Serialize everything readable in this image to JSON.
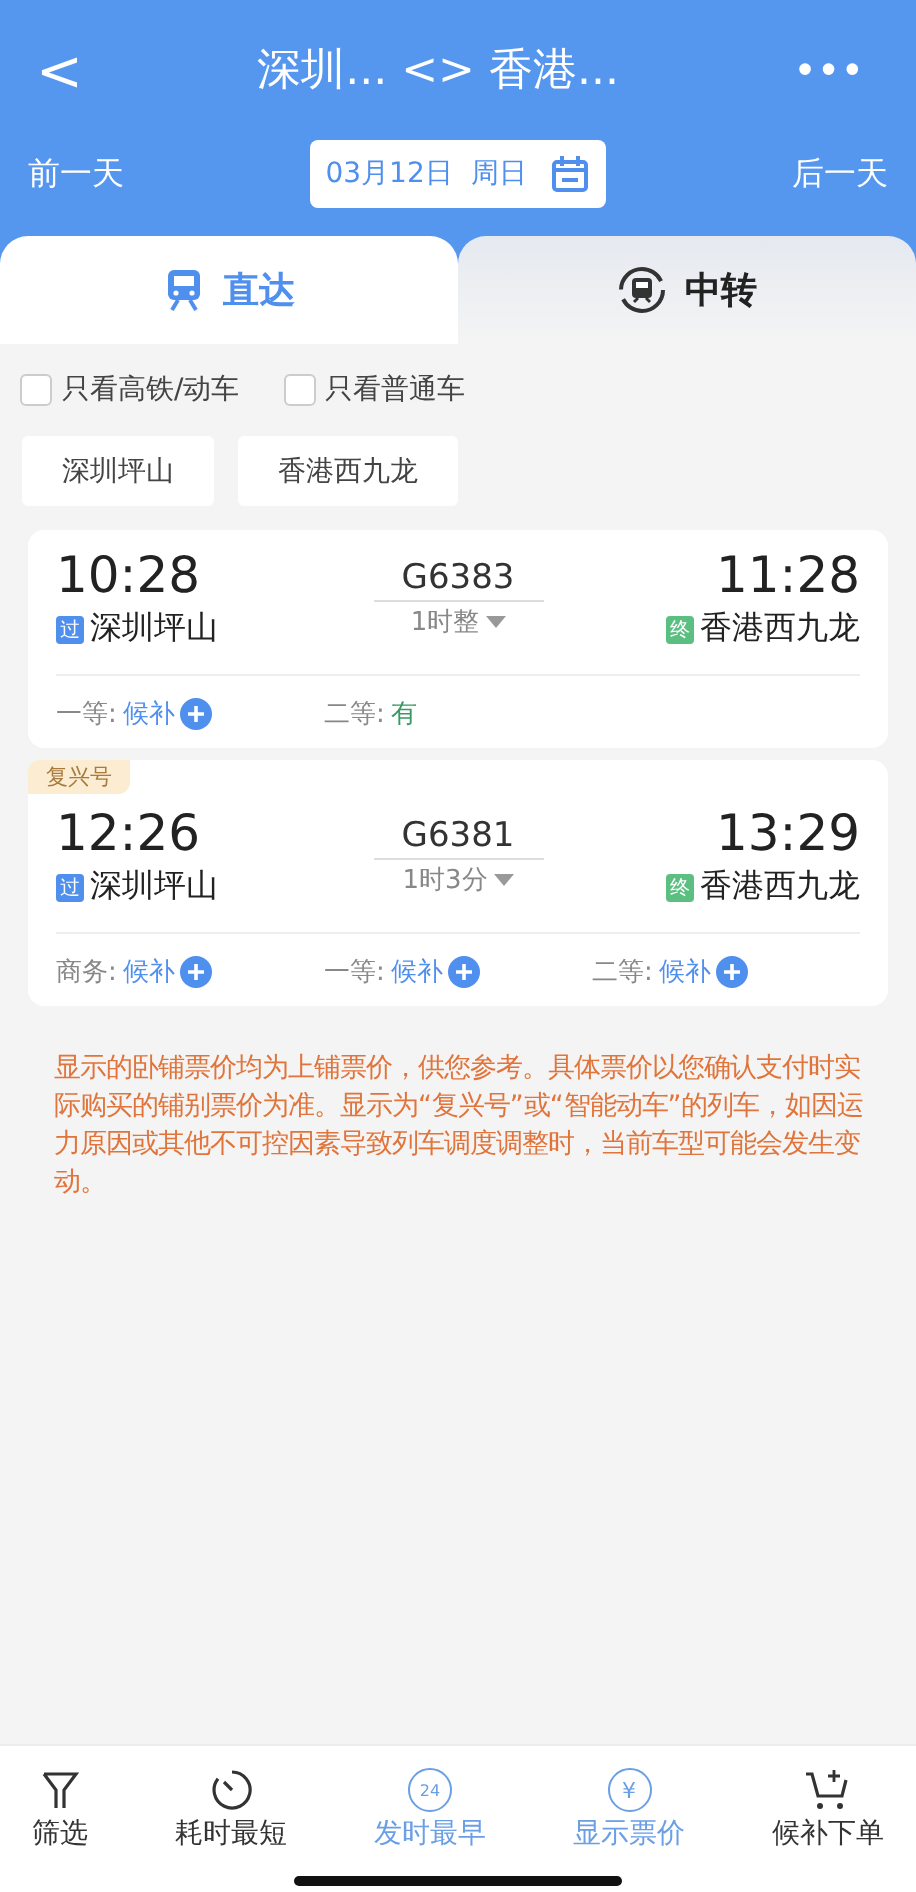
{
  "header": {
    "back": "<",
    "title": "深圳... <> 香港...",
    "more": "•••"
  },
  "date_bar": {
    "prev": "前一天",
    "date": "03月12日  周日",
    "next": "后一天"
  },
  "tabs": [
    {
      "label": "直达",
      "kind": "train",
      "selected": true
    },
    {
      "label": "中转",
      "kind": "transfer",
      "selected": false
    }
  ],
  "filters": [
    {
      "label": "只看高铁/动车",
      "checked": false
    },
    {
      "label": "只看普通车",
      "checked": false
    }
  ],
  "stations": [
    "深圳坪山",
    "香港西九龙"
  ],
  "trains": [
    {
      "depart": "10:28",
      "train_no": "G6383",
      "duration": "1时整",
      "arrive": "11:28",
      "from_tag": "过",
      "from": "深圳坪山",
      "to_tag": "终",
      "to": "香港西九龙",
      "seats": [
        {
          "label": "一等:",
          "status": "候补",
          "available": false
        },
        {
          "label": "二等:",
          "status": "有",
          "available": true
        }
      ]
    },
    {
      "badge": "复兴号",
      "depart": "12:26",
      "train_no": "G6381",
      "duration": "1时3分",
      "arrive": "13:29",
      "from_tag": "过",
      "from": "深圳坪山",
      "to_tag": "终",
      "to": "香港西九龙",
      "seats": [
        {
          "label": "商务:",
          "status": "候补",
          "available": false
        },
        {
          "label": "一等:",
          "status": "候补",
          "available": false
        },
        {
          "label": "二等:",
          "status": "候补",
          "available": false
        }
      ]
    }
  ],
  "notice": "显示的卧铺票价均为上铺票价，供您参考。具体票价以您确认支付时实际购买的铺别票价为准。显示为“复兴号”或“智能动车”的列车，如因运力原因或其他不可控因素导致列车调度调整时，当前车型可能会发生变动。",
  "bottom_bar": [
    {
      "label": "筛选",
      "kind": "filter",
      "selected": false
    },
    {
      "label": "耗时最短",
      "kind": "timer",
      "selected": false
    },
    {
      "label": "发时最早",
      "kind": "clock",
      "icon_text": "24",
      "selected": true
    },
    {
      "label": "显示票价",
      "kind": "price",
      "icon_text": "¥",
      "selected": true
    },
    {
      "label": "候补下单",
      "kind": "cart",
      "selected": false
    }
  ]
}
